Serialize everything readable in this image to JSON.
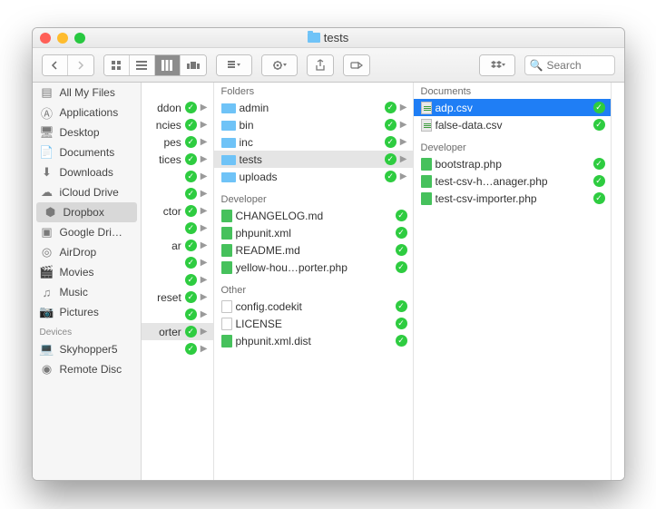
{
  "window": {
    "title": "tests"
  },
  "search": {
    "placeholder": "Search"
  },
  "sidebar": {
    "favorites": [
      {
        "label": "All My Files",
        "icon": "all-files"
      },
      {
        "label": "Applications",
        "icon": "apps"
      },
      {
        "label": "Desktop",
        "icon": "desktop"
      },
      {
        "label": "Documents",
        "icon": "documents"
      },
      {
        "label": "Downloads",
        "icon": "downloads"
      },
      {
        "label": "iCloud Drive",
        "icon": "icloud"
      },
      {
        "label": "Dropbox",
        "icon": "dropbox",
        "selected": true
      },
      {
        "label": "Google Dri…",
        "icon": "gdrive"
      },
      {
        "label": "AirDrop",
        "icon": "airdrop"
      },
      {
        "label": "Movies",
        "icon": "movies"
      },
      {
        "label": "Music",
        "icon": "music"
      },
      {
        "label": "Pictures",
        "icon": "pictures"
      }
    ],
    "devices_header": "Devices",
    "devices": [
      {
        "label": "Skyhopper5",
        "icon": "computer"
      },
      {
        "label": "Remote Disc",
        "icon": "disc"
      }
    ]
  },
  "col0": [
    {
      "name": "ddon",
      "synced": true
    },
    {
      "name": "ncies",
      "synced": true
    },
    {
      "name": "pes",
      "synced": true
    },
    {
      "name": "tices",
      "synced": true
    },
    {
      "name": "",
      "synced": true
    },
    {
      "name": "",
      "synced": true
    },
    {
      "name": "ctor",
      "synced": true
    },
    {
      "name": "",
      "synced": true
    },
    {
      "name": "ar",
      "synced": true
    },
    {
      "name": "",
      "synced": true
    },
    {
      "name": "",
      "synced": true
    },
    {
      "name": "reset",
      "synced": true
    },
    {
      "name": "",
      "synced": true
    },
    {
      "name": "orter",
      "synced": true,
      "selected": true
    },
    {
      "name": "",
      "synced": true
    }
  ],
  "col1": {
    "groups": [
      {
        "header": "Folders",
        "items": [
          {
            "name": "admin",
            "icon": "folder",
            "synced": true
          },
          {
            "name": "bin",
            "icon": "folder",
            "synced": true
          },
          {
            "name": "inc",
            "icon": "folder",
            "synced": true
          },
          {
            "name": "tests",
            "icon": "folder",
            "synced": true,
            "selected": true
          },
          {
            "name": "uploads",
            "icon": "folder",
            "synced": true
          }
        ]
      },
      {
        "header": "Developer",
        "items": [
          {
            "name": "CHANGELOG.md",
            "icon": "md",
            "synced": true
          },
          {
            "name": "phpunit.xml",
            "icon": "php",
            "synced": true
          },
          {
            "name": "README.md",
            "icon": "md",
            "synced": true
          },
          {
            "name": "yellow-hou…porter.php",
            "icon": "php",
            "synced": true
          }
        ]
      },
      {
        "header": "Other",
        "items": [
          {
            "name": "config.codekit",
            "icon": "doc",
            "synced": true
          },
          {
            "name": "LICENSE",
            "icon": "doc",
            "synced": true
          },
          {
            "name": "phpunit.xml.dist",
            "icon": "php",
            "synced": true
          }
        ]
      }
    ]
  },
  "col2": {
    "groups": [
      {
        "header": "Documents",
        "items": [
          {
            "name": "adp.csv",
            "icon": "csv",
            "synced": true,
            "active": true
          },
          {
            "name": "false-data.csv",
            "icon": "csv",
            "synced": true
          }
        ]
      },
      {
        "header": "Developer",
        "items": [
          {
            "name": "bootstrap.php",
            "icon": "php",
            "synced": true
          },
          {
            "name": "test-csv-h…anager.php",
            "icon": "php",
            "synced": true
          },
          {
            "name": "test-csv-importer.php",
            "icon": "php",
            "synced": true
          }
        ]
      }
    ]
  }
}
